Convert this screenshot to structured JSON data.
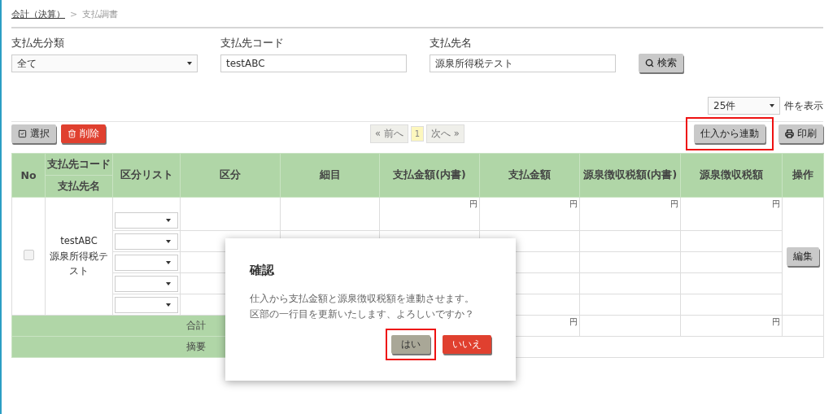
{
  "breadcrumb": [
    {
      "label": "会計（決算）",
      "link": true
    },
    {
      "label": "支払調書",
      "link": false
    }
  ],
  "breadcrumb_separator": ">",
  "filters": [
    {
      "label": "支払先分類",
      "kind": "select",
      "value": "全て"
    },
    {
      "label": "支払先コード",
      "kind": "input",
      "value": "testABC"
    },
    {
      "label": "支払先名",
      "kind": "input",
      "value": "源泉所得税テスト"
    }
  ],
  "search_button": "検索",
  "page_size": {
    "value": "25件",
    "suffix": "件を表示"
  },
  "toolbar": {
    "left_buttons": [
      {
        "label": "選択",
        "kind": "default"
      },
      {
        "label": "削除",
        "kind": "danger"
      }
    ],
    "pagination": {
      "prev": "« 前へ",
      "pages": [
        {
          "label": "1",
          "selected": true
        }
      ],
      "next": "次へ »"
    },
    "right_buttons": [
      {
        "label": "仕入から連動",
        "kind": "plain",
        "highlighted": true
      },
      {
        "label": "印刷",
        "kind": "print",
        "highlighted": false
      }
    ]
  },
  "table": {
    "columns": [
      {
        "label": "No"
      },
      {
        "label": "支払先コード",
        "sub": "支払先名"
      },
      {
        "label": "区分リスト"
      },
      {
        "label": "区分"
      },
      {
        "label": "細目"
      },
      {
        "label": "支払金額(内書)"
      },
      {
        "label": "支払金額"
      },
      {
        "label": "源泉徴収税額(内書)"
      },
      {
        "label": "源泉徴収税額"
      },
      {
        "label": "操作"
      }
    ],
    "record": {
      "checked": false,
      "code": "testABC",
      "name": "源泉所得税テスト",
      "edit_button": "編集",
      "lines": [
        {
          "kind": "yen",
          "units": [
            "円",
            "円",
            "円",
            "円"
          ]
        },
        {
          "kind": "blank"
        },
        {
          "kind": "blank"
        },
        {
          "kind": "blank"
        },
        {
          "kind": "blank"
        }
      ]
    },
    "total": {
      "label": "合計",
      "payment_unit": "円",
      "withholding_unit": "円"
    },
    "memo": {
      "label": "摘要"
    }
  },
  "dialog": {
    "title": "確認",
    "lines": [
      "仕入から支払金額と源泉徴収税額を連動させます。",
      "区部の一行目を更新いたします、よろしいですか？"
    ],
    "buttons": [
      {
        "label": "はい",
        "kind": "default",
        "highlighted": true
      },
      {
        "label": "いいえ",
        "kind": "danger",
        "highlighted": false
      }
    ]
  }
}
